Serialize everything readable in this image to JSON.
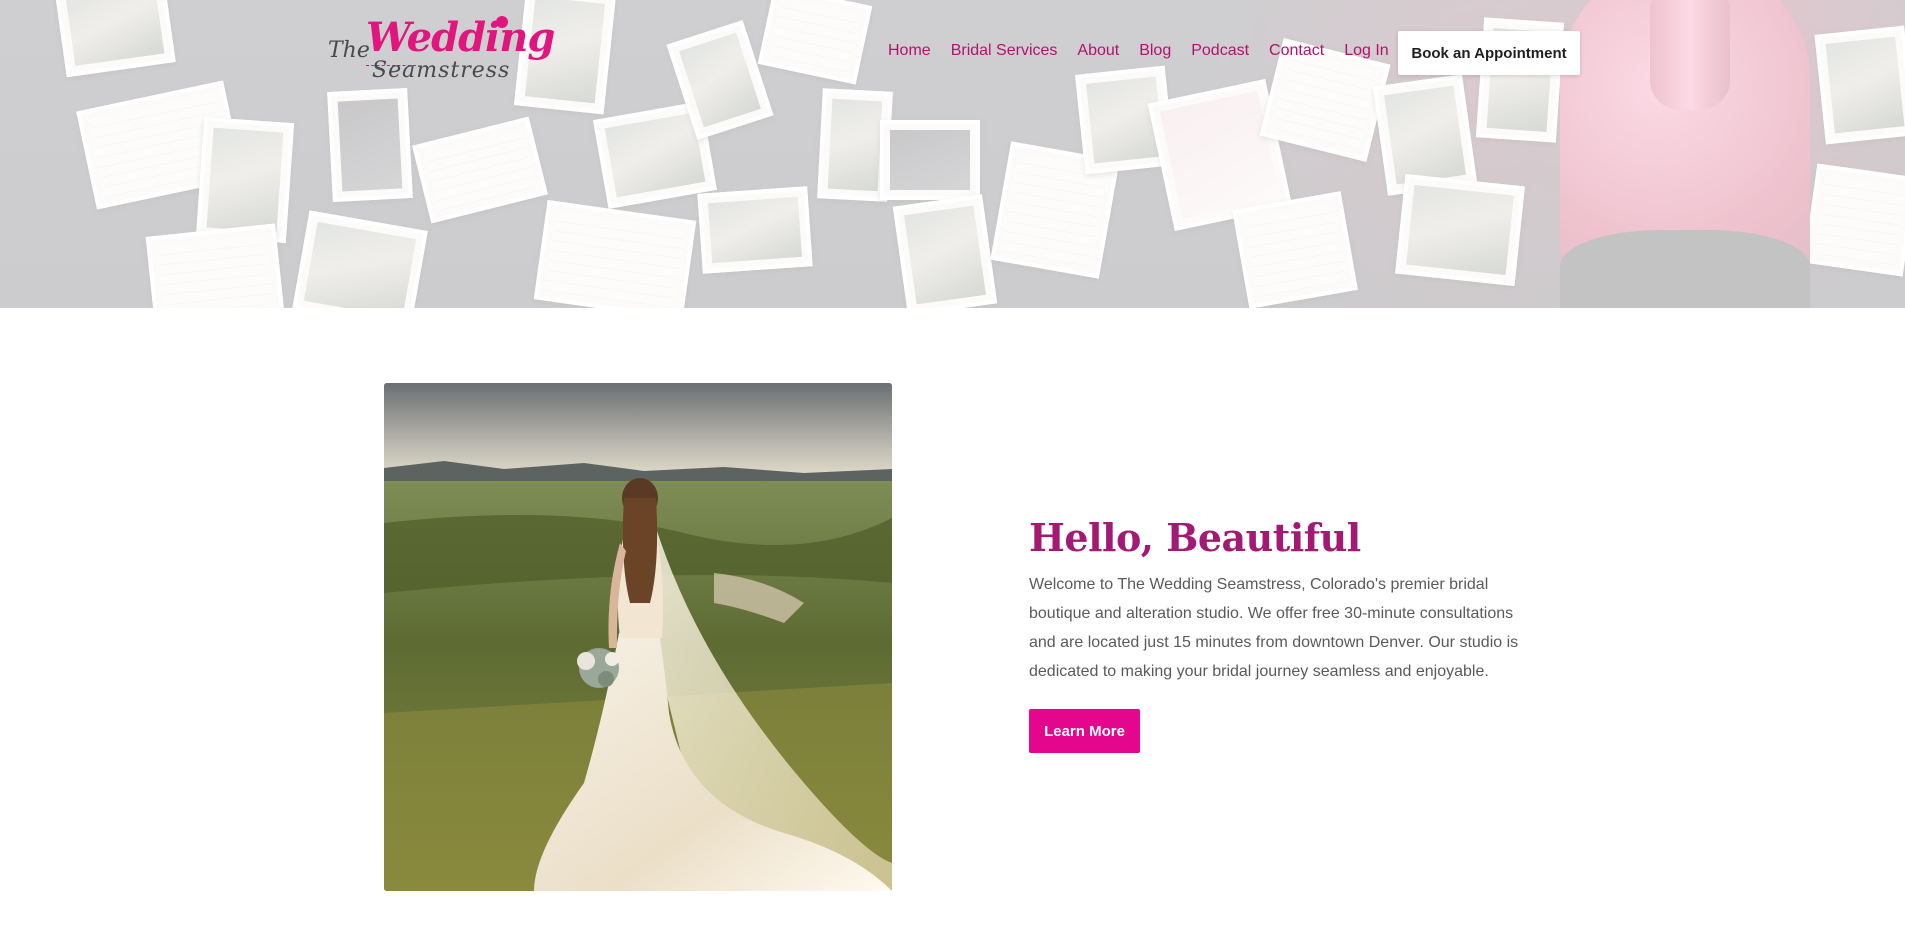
{
  "header": {
    "logo": {
      "the": "The",
      "wedding": "Wedding",
      "seamstress": "Seamstress"
    },
    "nav": [
      {
        "label": "Home"
      },
      {
        "label": "Bridal Services"
      },
      {
        "label": "About"
      },
      {
        "label": "Blog"
      },
      {
        "label": "Podcast"
      },
      {
        "label": "Contact"
      },
      {
        "label": "Log In"
      }
    ],
    "cta_label": "Book an Appointment"
  },
  "intro": {
    "title": "Hello, Beautiful",
    "body": "Welcome to The Wedding Seamstress, Colorado's premier bridal boutique and alteration studio. We offer free 30-minute consultations and are located just 15 minutes from downtown Denver. Our studio is dedicated to making your bridal journey seamless and enjoyable.",
    "button_label": "Learn More"
  },
  "colors": {
    "brand_pink": "#e4068c",
    "nav_text": "#b0136e",
    "heading": "#a21a73",
    "body_text": "#5a5a5a"
  }
}
